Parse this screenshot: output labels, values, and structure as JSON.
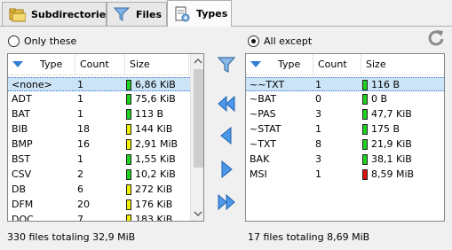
{
  "tabs": [
    {
      "label": "Subdirectories",
      "icon": "folder-icon"
    },
    {
      "label": "Files",
      "icon": "filter-icon"
    },
    {
      "label": "Types",
      "icon": "document-gear-icon"
    }
  ],
  "left": {
    "radio_label": "Only these",
    "columns": [
      "Type",
      "Count",
      "Size"
    ],
    "rows": [
      {
        "type": "<none>",
        "count": "1",
        "size": "6,86 KiB",
        "level": "green",
        "selected": true
      },
      {
        "type": "ADT",
        "count": "1",
        "size": "75,6 KiB",
        "level": "green"
      },
      {
        "type": "BAT",
        "count": "1",
        "size": "113 B",
        "level": "green"
      },
      {
        "type": "BIB",
        "count": "18",
        "size": "144 KiB",
        "level": "yellow"
      },
      {
        "type": "BMP",
        "count": "16",
        "size": "2,91 MiB",
        "level": "yellow"
      },
      {
        "type": "BST",
        "count": "1",
        "size": "1,55 KiB",
        "level": "green"
      },
      {
        "type": "CSV",
        "count": "2",
        "size": "10,2 KiB",
        "level": "green"
      },
      {
        "type": "DB",
        "count": "6",
        "size": "272 KiB",
        "level": "yellow"
      },
      {
        "type": "DFM",
        "count": "20",
        "size": "176 KiB",
        "level": "yellow"
      },
      {
        "type": "DOC",
        "count": "7",
        "size": "183 KiB",
        "level": "yellow"
      }
    ],
    "status": "330 files totaling 32,9 MiB"
  },
  "right": {
    "radio_label": "All except",
    "columns": [
      "Type",
      "Count",
      "Size"
    ],
    "rows": [
      {
        "type": "~~TXT",
        "count": "1",
        "size": "116 B",
        "level": "green",
        "selected": true
      },
      {
        "type": "~BAT",
        "count": "0",
        "size": "0 B",
        "level": "green"
      },
      {
        "type": "~PAS",
        "count": "3",
        "size": "47,7 KiB",
        "level": "green"
      },
      {
        "type": "~STAT",
        "count": "1",
        "size": "175 B",
        "level": "green"
      },
      {
        "type": "~TXT",
        "count": "8",
        "size": "21,9 KiB",
        "level": "green"
      },
      {
        "type": "BAK",
        "count": "3",
        "size": "38,1 KiB",
        "level": "green"
      },
      {
        "type": "MSI",
        "count": "1",
        "size": "8,59 MiB",
        "level": "red"
      }
    ],
    "status": "17 files totaling 8,69 MiB"
  },
  "colors": {
    "green": "#1fd21f",
    "yellow": "#f2f200",
    "red": "#e01010",
    "selection": "#cce4f7",
    "accent": "#2f7cd3"
  },
  "buttons": [
    "filter-icon",
    "move-all-left-icon",
    "move-left-icon",
    "move-right-icon",
    "move-all-right-icon",
    "reset-icon"
  ]
}
